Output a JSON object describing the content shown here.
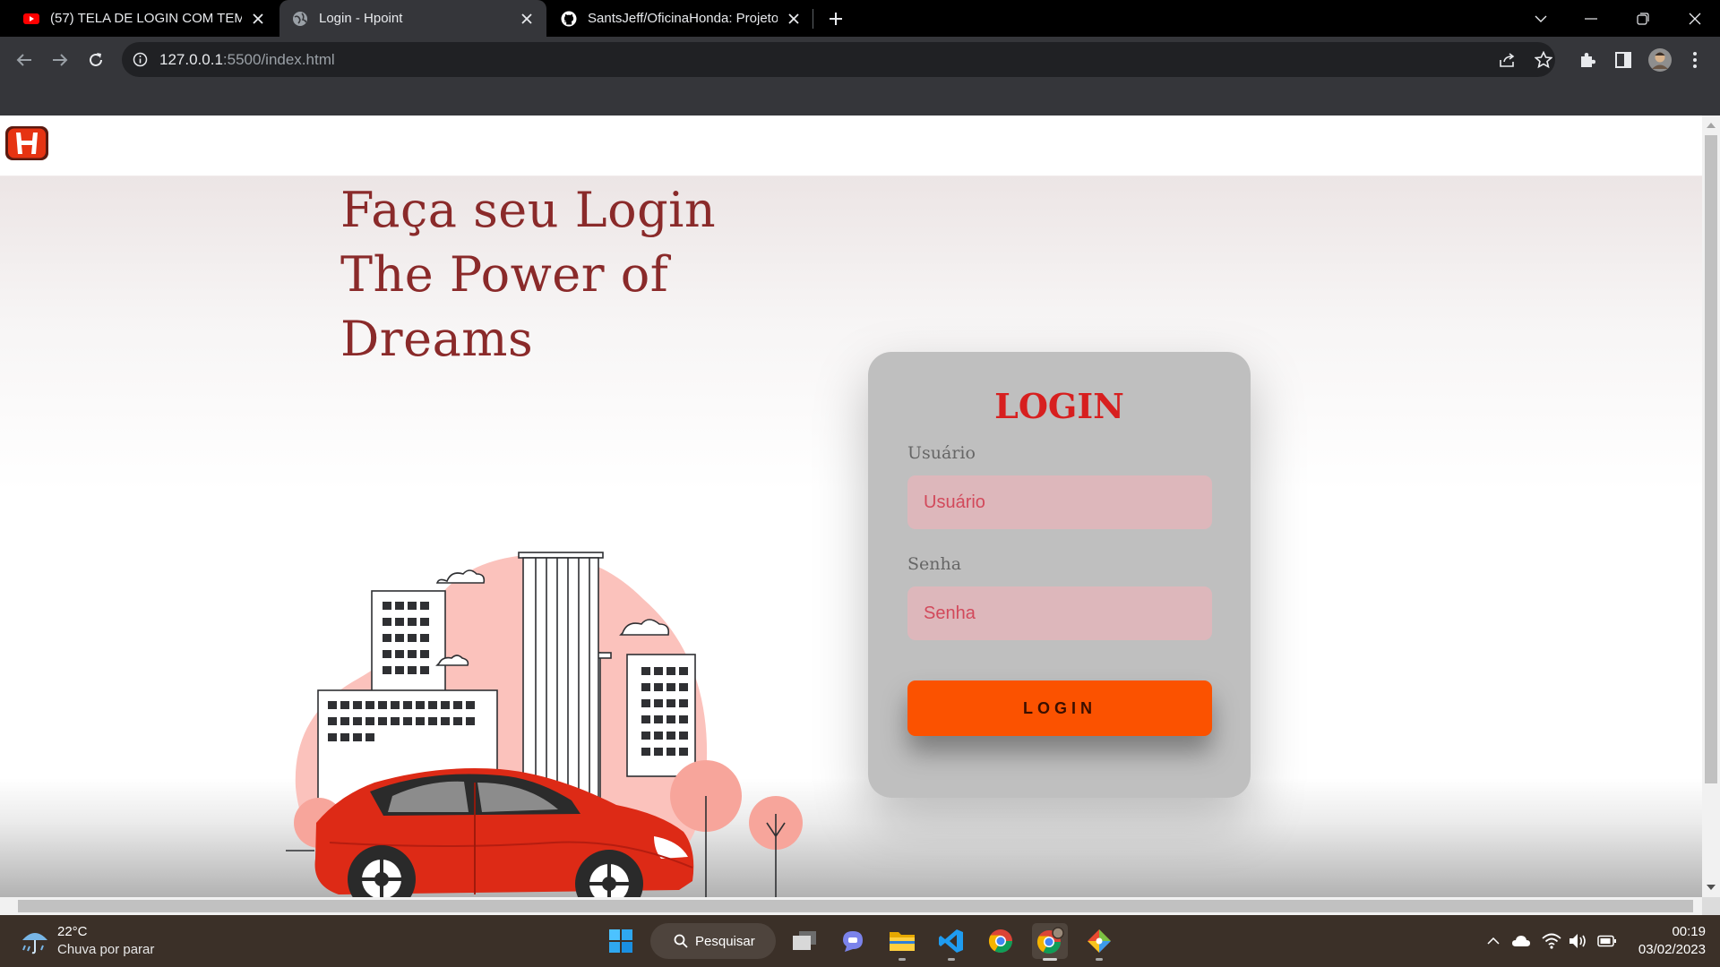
{
  "browser": {
    "tabs": [
      {
        "title": "(57) TELA DE LOGIN COM TEMA",
        "favicon": "youtube-icon"
      },
      {
        "title": "Login - Hpoint",
        "favicon": "globe-icon",
        "active": true
      },
      {
        "title": "SantsJeff/OficinaHonda: Projeto",
        "favicon": "github-icon"
      }
    ],
    "url_host": "127.0.0.1",
    "url_rest": ":5500/index.html"
  },
  "page": {
    "hero_lines": [
      "Faça seu Login",
      "The Power of",
      "Dreams"
    ],
    "login": {
      "title": "LOGIN",
      "user_label": "Usuário",
      "user_placeholder": "Usuário",
      "pass_label": "Senha",
      "pass_placeholder": "Senha",
      "button_label": "LOGIN"
    },
    "colors": {
      "accent": "#fb5200",
      "title_red": "#d71f1f",
      "hero": "#8a2a2a",
      "field_bg": "#ddb7bb"
    }
  },
  "taskbar": {
    "weather_temp": "22°C",
    "weather_desc": "Chuva por parar",
    "search_label": "Pesquisar",
    "time": "00:19",
    "date": "03/02/2023"
  }
}
